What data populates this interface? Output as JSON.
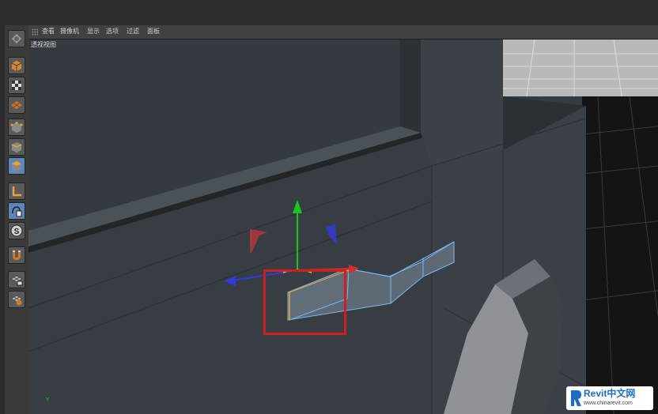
{
  "menu": {
    "items": [
      "查看",
      "摄像机",
      "显示",
      "选项",
      "过滤",
      "面板"
    ]
  },
  "viewport": {
    "label": "透视视图",
    "axis_label": "Y"
  },
  "toolbar": {
    "tools": [
      {
        "name": "undo-icon",
        "active": false
      },
      {
        "name": "model-mode-icon",
        "active": false
      },
      {
        "name": "texture-mode-icon",
        "active": false
      },
      {
        "name": "workplane-icon",
        "active": false
      },
      {
        "name": "points-mode-icon",
        "active": false
      },
      {
        "name": "edges-mode-icon",
        "active": false
      },
      {
        "name": "polygons-mode-icon",
        "active": true
      },
      {
        "name": "axis-mode-icon",
        "active": false
      },
      {
        "name": "tweak-mode-icon",
        "active": true
      },
      {
        "name": "snap-icon",
        "active": false
      },
      {
        "name": "magnet-icon",
        "active": false
      },
      {
        "name": "lock-workplane-icon",
        "active": false
      },
      {
        "name": "planar-workplane-icon",
        "active": false
      }
    ]
  },
  "watermark": {
    "brand": "Revit中文网",
    "url": "www.chinarevit.com"
  },
  "colors": {
    "y_axis": "#1ec31e",
    "x_axis": "#e02a2a",
    "z_axis": "#3438d6",
    "selection": "#7cb7ea",
    "highlight_box": "#cc1f1f"
  }
}
